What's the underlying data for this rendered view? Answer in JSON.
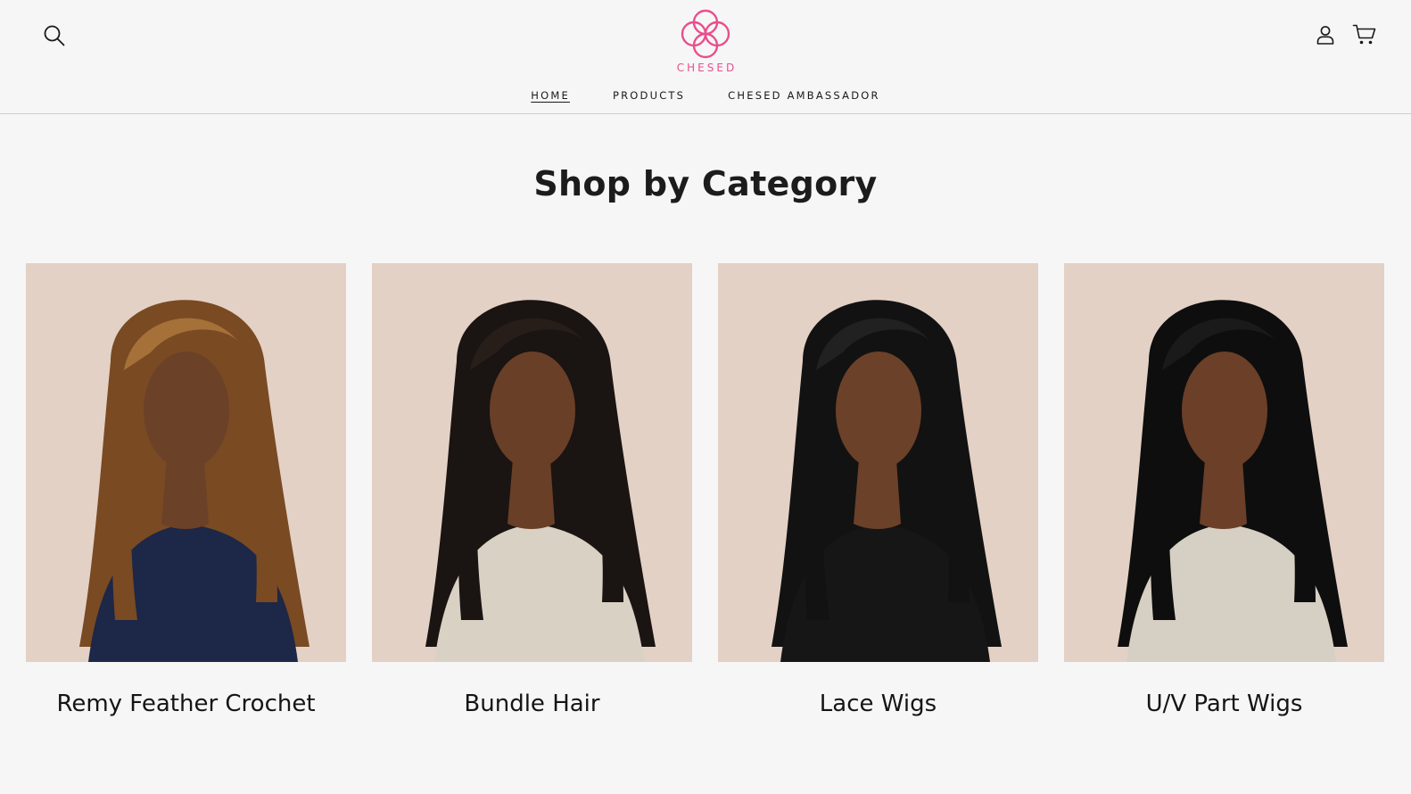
{
  "header": {
    "logo_text": "CHESED",
    "search_icon": "search-icon",
    "account_icon": "user-icon",
    "cart_icon": "cart-icon",
    "brand_color": "#e84f8c"
  },
  "nav": {
    "items": [
      {
        "label": "HOME",
        "active": true
      },
      {
        "label": "PRODUCTS",
        "active": false
      },
      {
        "label": "CHESED AMBASSADOR",
        "active": false
      }
    ]
  },
  "main": {
    "title": "Shop by Category",
    "categories": [
      {
        "label": "Remy Feather Crochet",
        "hair_color": "#7a4a22",
        "highlight": "#b07a3e",
        "top_color": "#1d2747",
        "skin": "#6b4128"
      },
      {
        "label": "Bundle Hair",
        "hair_color": "#1a1412",
        "highlight": "#2a201c",
        "top_color": "#d8d1c4",
        "skin": "#6a3f27"
      },
      {
        "label": "Lace Wigs",
        "hair_color": "#121212",
        "highlight": "#262626",
        "top_color": "#161616",
        "skin": "#6c4129"
      },
      {
        "label": "U/V Part Wigs",
        "hair_color": "#0e0e0e",
        "highlight": "#1e1e1e",
        "top_color": "#d6cfc3",
        "skin": "#6b3f28"
      }
    ]
  }
}
